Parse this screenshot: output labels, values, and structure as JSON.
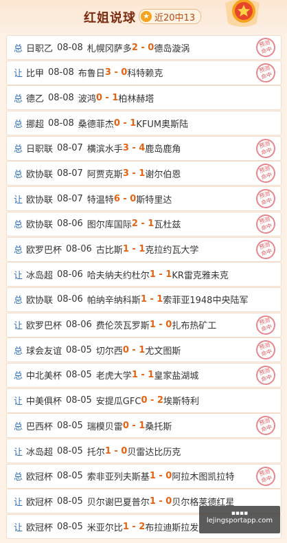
{
  "header": {
    "title": "红姐说球",
    "badge": "近20中13"
  },
  "stamp_text": [
    "预测",
    "命中"
  ],
  "watermark": {
    "line1": "▪▪▪▪",
    "line2": "lejingsportapp.com"
  },
  "rows": [
    {
      "type": "总",
      "league": "日职乙",
      "date": "08-08",
      "home": "札幌冈萨多",
      "score": "2 - 0",
      "away": "德岛漩涡",
      "hit": true
    },
    {
      "type": "让",
      "league": "比甲",
      "date": "08-08",
      "home": "布鲁日",
      "score": "3 - 0",
      "away": "科特赖克",
      "hit": true
    },
    {
      "type": "总",
      "league": "德乙",
      "date": "08-08",
      "home": "波鸿",
      "score": "0 - 1",
      "away": "柏林赫塔",
      "hit": false
    },
    {
      "type": "总",
      "league": "挪超",
      "date": "08-08",
      "home": "桑德菲杰",
      "score": "0 - 1",
      "away": "KFUM奥斯陆",
      "hit": false
    },
    {
      "type": "总",
      "league": "日职联",
      "date": "08-07",
      "home": "横滨水手",
      "score": "3 - 4",
      "away": "鹿岛鹿角",
      "hit": true
    },
    {
      "type": "总",
      "league": "欧协联",
      "date": "08-07",
      "home": "阿贾克斯",
      "score": "3 - 1",
      "away": "谢尔伯恩",
      "hit": true
    },
    {
      "type": "让",
      "league": "欧协联",
      "date": "08-07",
      "home": "特温特",
      "score": "6 - 0",
      "away": "斯特里达",
      "hit": true
    },
    {
      "type": "总",
      "league": "欧协联",
      "date": "08-06",
      "home": "图尔库国际",
      "score": "2 - 1",
      "away": "瓦杜兹",
      "hit": true
    },
    {
      "type": "总",
      "league": "欧罗巴杯",
      "date": "08-06",
      "home": "古比斯",
      "score": "1 - 1",
      "away": "克拉约瓦大学",
      "hit": true
    },
    {
      "type": "让",
      "league": "冰岛超",
      "date": "08-06",
      "home": "哈夫纳夫约杜尔",
      "score": "1 - 1",
      "away": "KR雷克雅未克",
      "hit": false
    },
    {
      "type": "总",
      "league": "欧协联",
      "date": "08-06",
      "home": "帕纳辛纳科斯",
      "score": "1 - 1",
      "away": "索菲亚1948中央陆军",
      "hit": false
    },
    {
      "type": "让",
      "league": "欧罗巴杯",
      "date": "08-06",
      "home": "费伦茨瓦罗斯",
      "score": "1 - 0",
      "away": "扎布热矿工",
      "hit": true
    },
    {
      "type": "总",
      "league": "球会友谊",
      "date": "08-05",
      "home": "切尔西",
      "score": "0 - 1",
      "away": "尤文图斯",
      "hit": true
    },
    {
      "type": "总",
      "league": "中北美杯",
      "date": "08-05",
      "home": "老虎大学",
      "score": "1 - 1",
      "away": "皇家盐湖城",
      "hit": true
    },
    {
      "type": "让",
      "league": "中美俱杯",
      "date": "08-05",
      "home": "安提瓜GFC",
      "score": "0 - 2",
      "away": "埃斯特利",
      "hit": false
    },
    {
      "type": "总",
      "league": "巴西杯",
      "date": "08-05",
      "home": "瑞模贝雷",
      "score": "0 - 1",
      "away": "桑托斯",
      "hit": true
    },
    {
      "type": "让",
      "league": "冰岛超",
      "date": "08-05",
      "home": "托尔",
      "score": "1 - 0",
      "away": "贝雷达比历克",
      "hit": false
    },
    {
      "type": "总",
      "league": "欧冠杯",
      "date": "08-05",
      "home": "索非亚列夫斯基",
      "score": "1 - 0",
      "away": "阿拉木图凯拉特",
      "hit": true
    },
    {
      "type": "让",
      "league": "欧冠杯",
      "date": "08-05",
      "home": "贝尔谢巴夏普尔",
      "score": "1 - 0",
      "away": "贝尔格莱德红星",
      "hit": false
    },
    {
      "type": "让",
      "league": "欧冠杯",
      "date": "08-05",
      "home": "米亚尔比",
      "score": "1 - 2",
      "away": "布拉迪斯拉发",
      "hit": false
    }
  ]
}
